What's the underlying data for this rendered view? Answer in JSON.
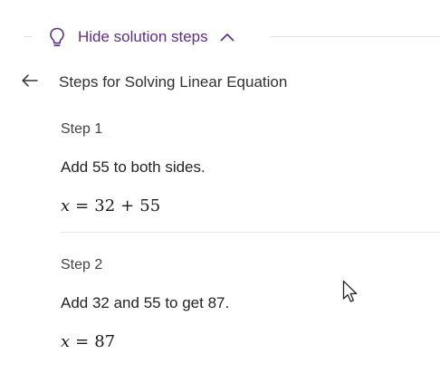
{
  "solution_toggle": {
    "label": "Hide solution steps",
    "icon": "lightbulb-icon",
    "chevron": "chevron-up-icon",
    "accent_color": "#5c2d91"
  },
  "header": {
    "back_icon": "arrow-left-icon",
    "title": "Steps for Solving Linear Equation"
  },
  "steps": [
    {
      "heading": "Step 1",
      "text": "Add 55 to both sides.",
      "equation": {
        "lhs": "x",
        "op": "=",
        "rhs_a": "32",
        "rhs_op": "+",
        "rhs_b": "55"
      }
    },
    {
      "heading": "Step 2",
      "text": "Add 32 and 55 to get 87.",
      "equation": {
        "lhs": "x",
        "op": "=",
        "rhs": "87"
      }
    }
  ]
}
